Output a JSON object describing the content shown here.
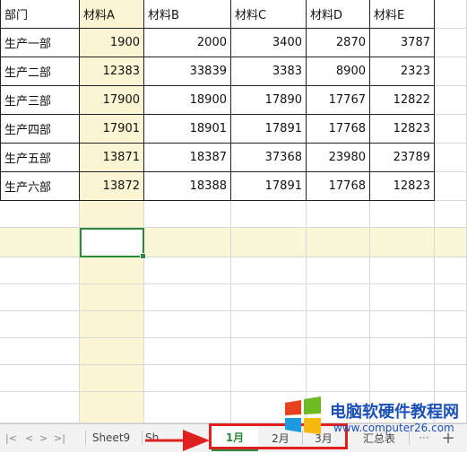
{
  "sheet": {
    "headers": [
      "部门",
      "材料A",
      "材料B",
      "材料C",
      "材料D",
      "材料E"
    ],
    "rows": [
      [
        "生产一部",
        "1900",
        "2000",
        "3400",
        "2870",
        "3787"
      ],
      [
        "生产二部",
        "12383",
        "33839",
        "3383",
        "8900",
        "2323"
      ],
      [
        "生产三部",
        "17900",
        "18900",
        "17890",
        "17767",
        "12822"
      ],
      [
        "生产四部",
        "17901",
        "18901",
        "17891",
        "17768",
        "12823"
      ],
      [
        "生产五部",
        "13871",
        "18387",
        "37368",
        "23980",
        "23789"
      ],
      [
        "生产六部",
        "13872",
        "18388",
        "17891",
        "17768",
        "12823"
      ]
    ]
  },
  "tabs": {
    "nav_first": "|<",
    "nav_prev": "<",
    "nav_next": ">",
    "nav_last": ">|",
    "items": [
      "Sheet9",
      "Sh",
      "1月",
      "2月",
      "3月",
      "汇总表"
    ],
    "active": "1月",
    "more": "···",
    "add": "+"
  },
  "watermark": {
    "title": "电脑软硬件教程网",
    "url": "www.computer26.com"
  },
  "colors": {
    "selection": "#2d8a3a",
    "highlight_column": "#fbf5d4",
    "annotation_red": "#e02020",
    "watermark_blue": "#1a4fb8"
  }
}
